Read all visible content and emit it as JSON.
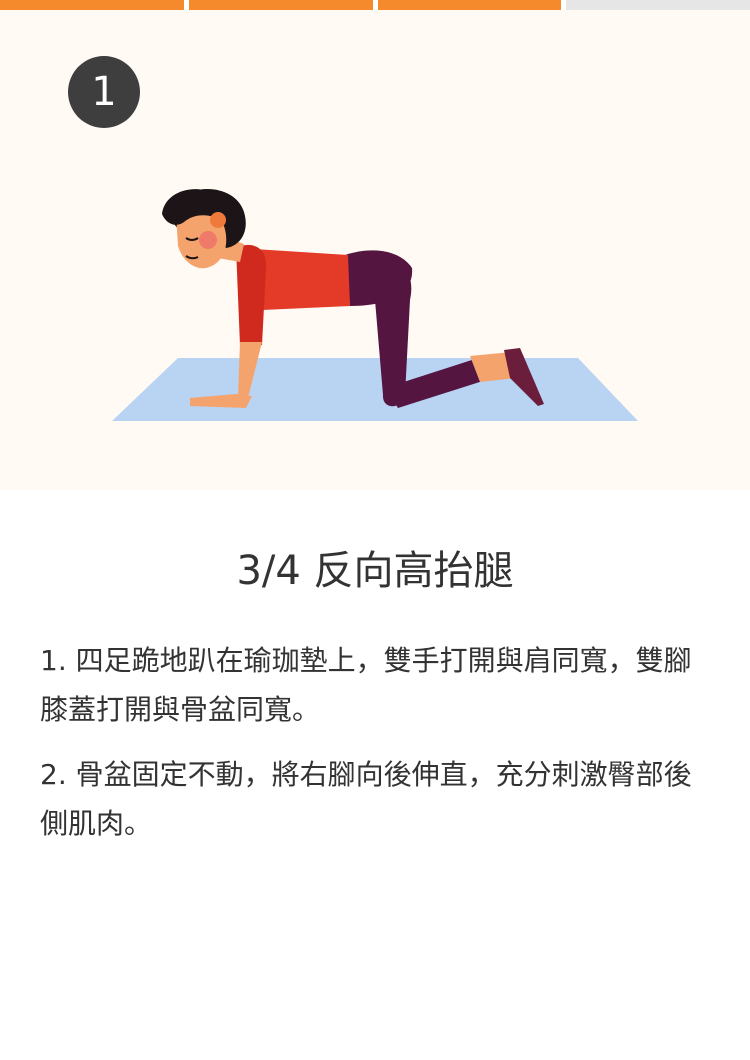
{
  "progress": {
    "total": 4,
    "completed": 3,
    "active_color": "#f58a2c",
    "inactive_color": "#e6e6e6"
  },
  "illustration": {
    "background": "#fffaf3",
    "step_number": "1"
  },
  "exercise": {
    "title": "3/4 反向高抬腿",
    "steps": [
      "1. 四足跪地趴在瑜珈墊上，雙手打開與肩同寬，雙腳膝蓋打開與骨盆同寬。",
      "2. 骨盆固定不動，將右腳向後伸直，充分刺激臀部後側肌肉。"
    ]
  },
  "colors": {
    "mat": "#b9d3f3",
    "shirt": "#e33b28",
    "pants": "#541540",
    "skin": "#f5a36c",
    "hair": "#1c1416"
  }
}
